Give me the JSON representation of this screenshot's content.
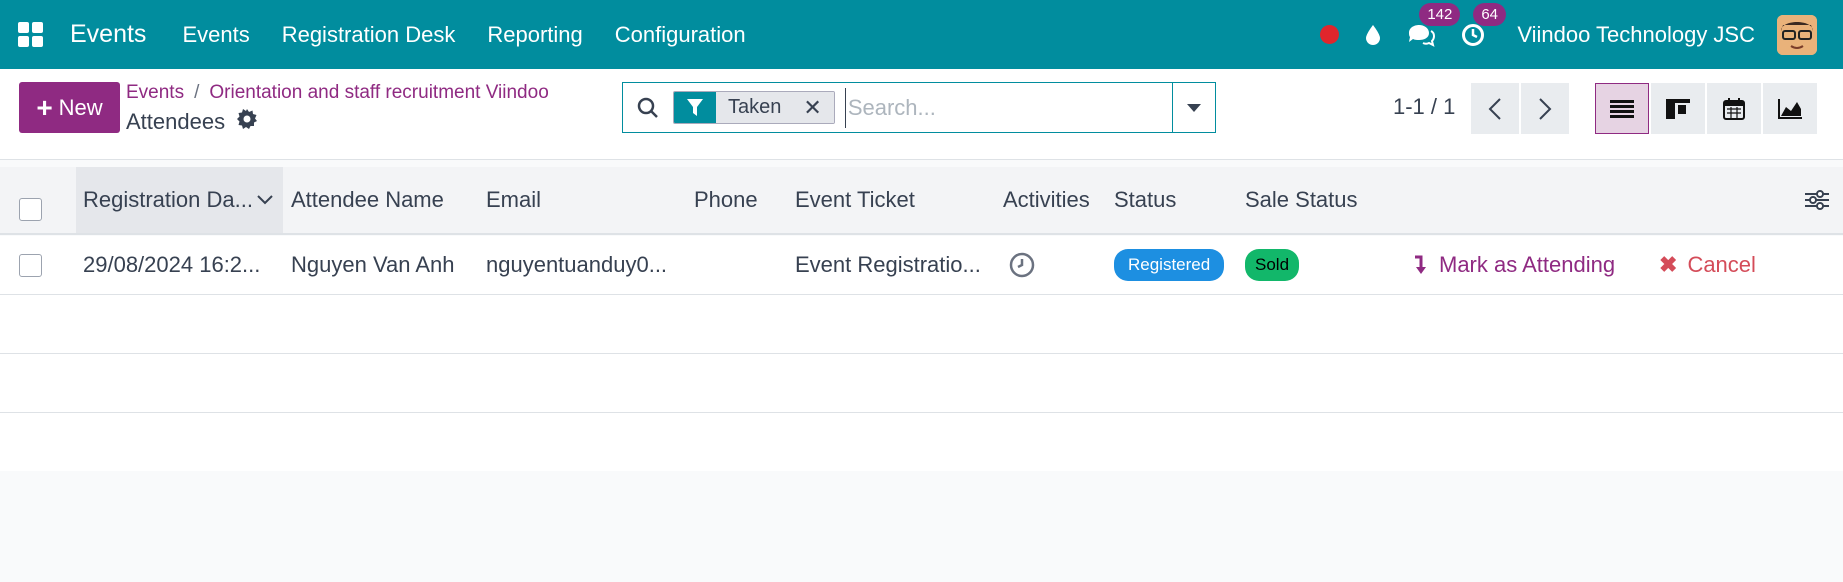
{
  "navbar": {
    "brand": "Events",
    "menu": [
      "Events",
      "Registration Desk",
      "Reporting",
      "Configuration"
    ],
    "messages_count": "142",
    "activities_count": "64",
    "company": "Viindoo Technology JSC"
  },
  "control": {
    "new_label": "New",
    "breadcrumb": [
      "Events",
      "Orientation and staff recruitment Viindoo"
    ],
    "title": "Attendees",
    "search": {
      "facet": "Taken",
      "placeholder": "Search..."
    },
    "pager": "1-1 / 1"
  },
  "table": {
    "columns": [
      "Registration Da...",
      "Attendee Name",
      "Email",
      "Phone",
      "Event Ticket",
      "Activities",
      "Status",
      "Sale Status"
    ],
    "rows": [
      {
        "registration_date": "29/08/2024 16:2...",
        "attendee_name": "Nguyen Van Anh",
        "email": "nguyentuanduy0...",
        "phone": "",
        "event_ticket": "Event Registratio...",
        "status": "Registered",
        "sale_status": "Sold",
        "action_attend": "Mark as Attending",
        "action_cancel": "Cancel"
      }
    ]
  },
  "colors": {
    "navbar": "#018d9e",
    "primary": "#8f2a82",
    "registered": "#1d8fe1",
    "sold": "#12b76a",
    "cancel": "#d44c59"
  }
}
